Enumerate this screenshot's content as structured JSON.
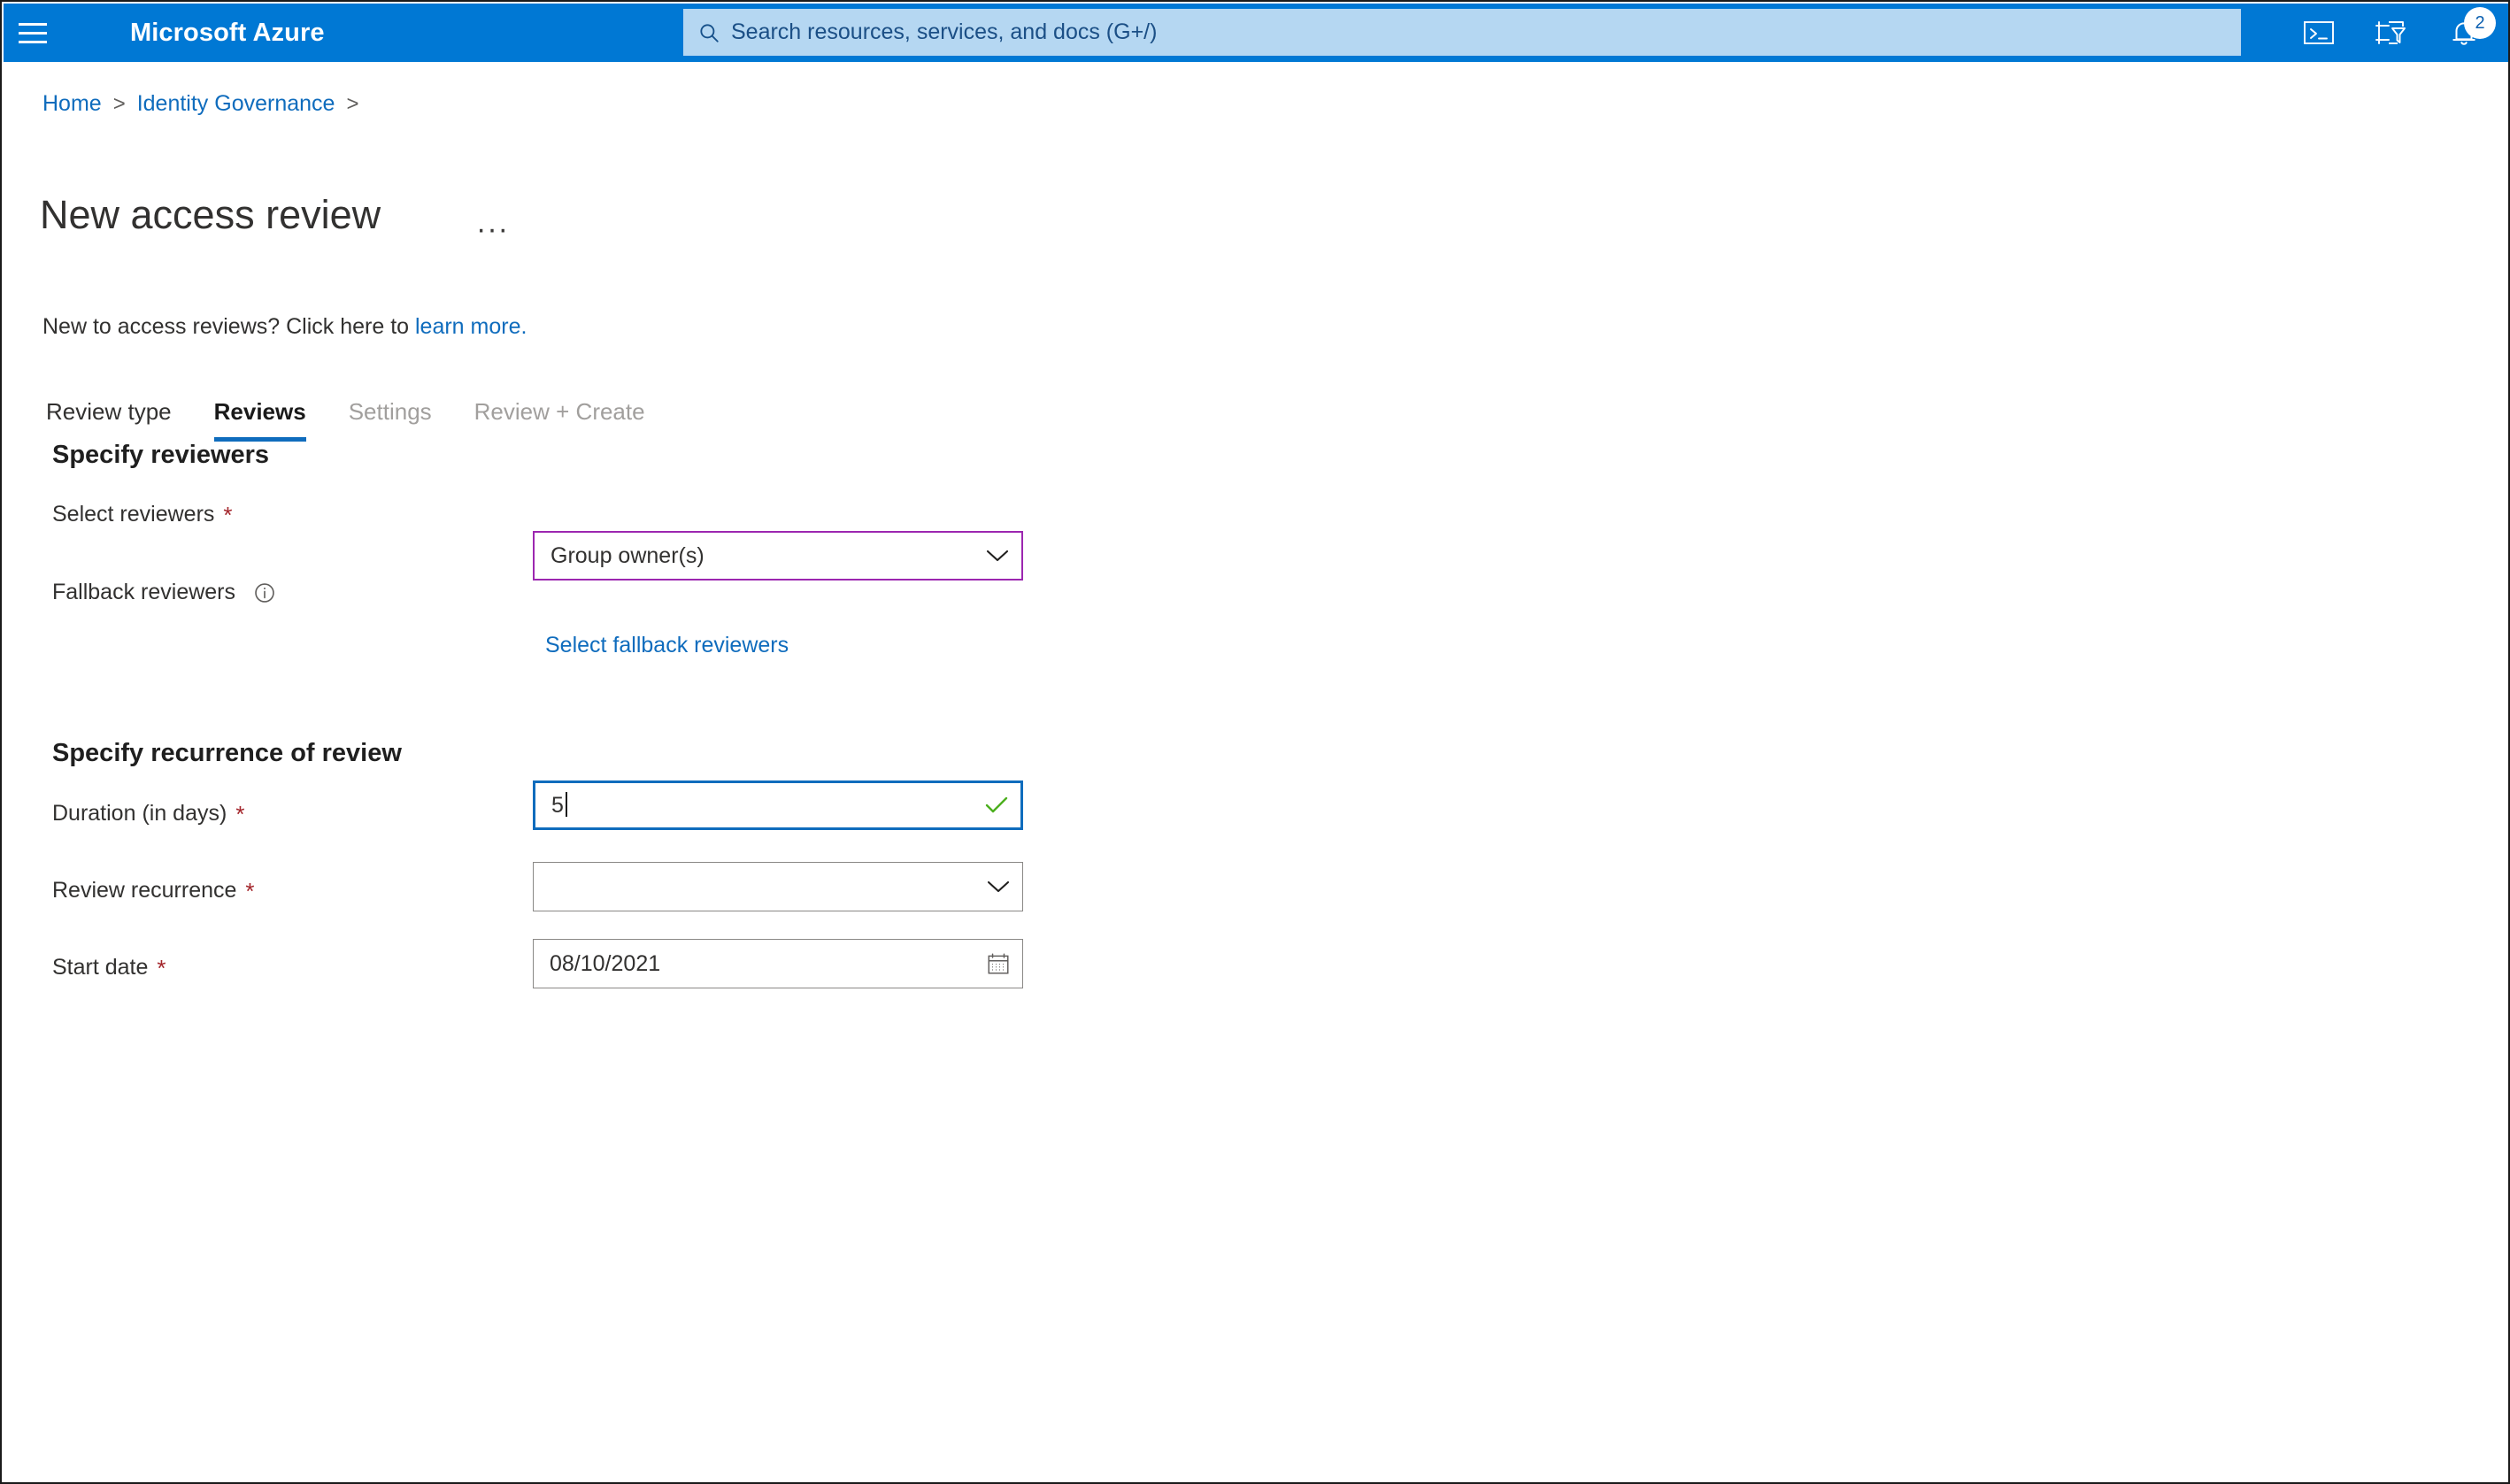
{
  "topbar": {
    "menu_icon": "hamburger-icon",
    "brand": "Microsoft Azure",
    "search": {
      "icon": "search-icon",
      "placeholder": "Search resources, services, and docs (G+/)",
      "value": ""
    },
    "icons": [
      {
        "name": "cloud-shell-icon",
        "label": "Cloud Shell"
      },
      {
        "name": "directory-filter-icon",
        "label": "Directories + subscriptions"
      },
      {
        "name": "notifications-bell-icon",
        "label": "Notifications",
        "badge": "2"
      }
    ],
    "accent_color": "#0078d4",
    "search_bg": "#b5d7f2"
  },
  "breadcrumb": {
    "items": [
      {
        "label": "Home",
        "is_link": true
      },
      {
        "label": "Identity Governance",
        "is_link": true
      }
    ],
    "separator": ">"
  },
  "page": {
    "title": "New access review",
    "more_actions": "···",
    "intro_prefix": "New to access reviews? Click here to ",
    "intro_link": "learn more."
  },
  "tabs": [
    {
      "label": "Review type",
      "state": "enabled"
    },
    {
      "label": "Reviews",
      "state": "selected"
    },
    {
      "label": "Settings",
      "state": "disabled"
    },
    {
      "label": "Review + Create",
      "state": "disabled"
    }
  ],
  "sections": [
    {
      "heading": "Specify reviewers",
      "fields": [
        {
          "label": "Select reviewers",
          "required": true,
          "control": "dropdown",
          "value": "Group owner(s)",
          "border": "purple",
          "adornment": "chevron-down-icon"
        },
        {
          "label": "Fallback reviewers",
          "required": false,
          "info_icon": "info-icon",
          "control": "link",
          "value": "Select fallback reviewers"
        }
      ]
    },
    {
      "heading": "Specify recurrence of review",
      "fields": [
        {
          "label": "Duration (in days)",
          "required": true,
          "control": "textbox",
          "value": "5",
          "border": "blue",
          "focused": true,
          "adornment": "validation-check-icon"
        },
        {
          "label": "Review recurrence",
          "required": true,
          "control": "dropdown",
          "value": "",
          "border": "default",
          "adornment": "chevron-down-icon"
        },
        {
          "label": "Start date",
          "required": true,
          "control": "datepicker",
          "value": "08/10/2021",
          "border": "default",
          "adornment": "calendar-icon"
        }
      ]
    }
  ],
  "colors": {
    "azure_blue": "#0078d4",
    "link_blue": "#0f6cbd",
    "required_red": "#a4262c",
    "purple_border": "#9c27b0",
    "focus_blue": "#0f6cbd",
    "success_green": "#498205",
    "disabled_gray": "#a19f9d"
  }
}
